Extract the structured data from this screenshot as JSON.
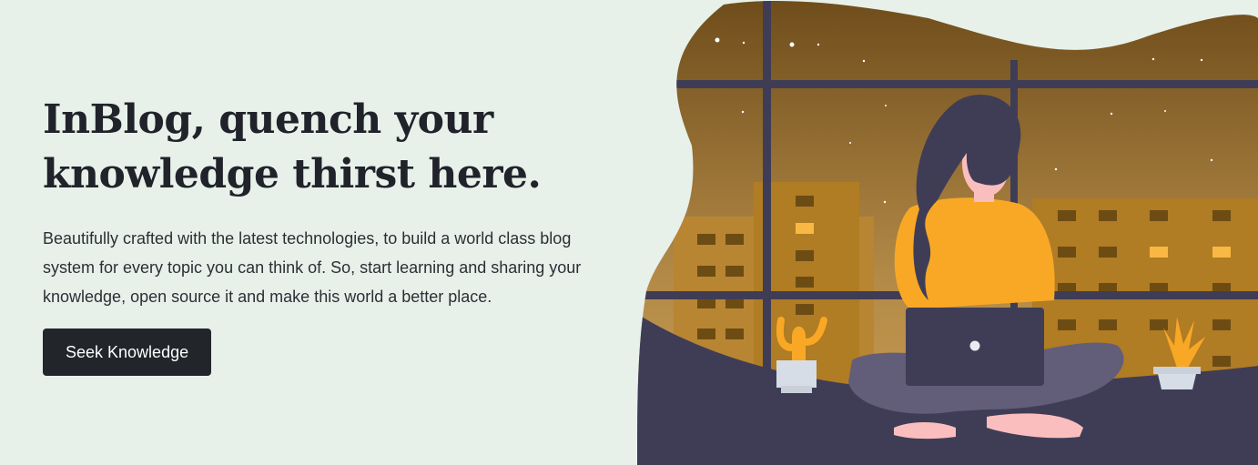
{
  "hero": {
    "title_line1": "InBlog, quench your",
    "title_line2": "knowledge thirst here.",
    "description": "Beautifully crafted with the latest technologies, to build a world class blog system for every topic you can think of. So, start learning and sharing your knowledge, open source it and make this world a better place.",
    "cta_label": "Seek Knowledge"
  },
  "colors": {
    "background": "#e7f1ea",
    "button": "#22252a",
    "sky_top": "#6f4d1b",
    "sky_bottom": "#c99c52",
    "building": "#b07c24",
    "window_frame": "#3f3d56",
    "sweater": "#f9a826",
    "skin": "#fbbebe"
  },
  "illustration": {
    "icon": "woman-with-laptop-illustration"
  }
}
